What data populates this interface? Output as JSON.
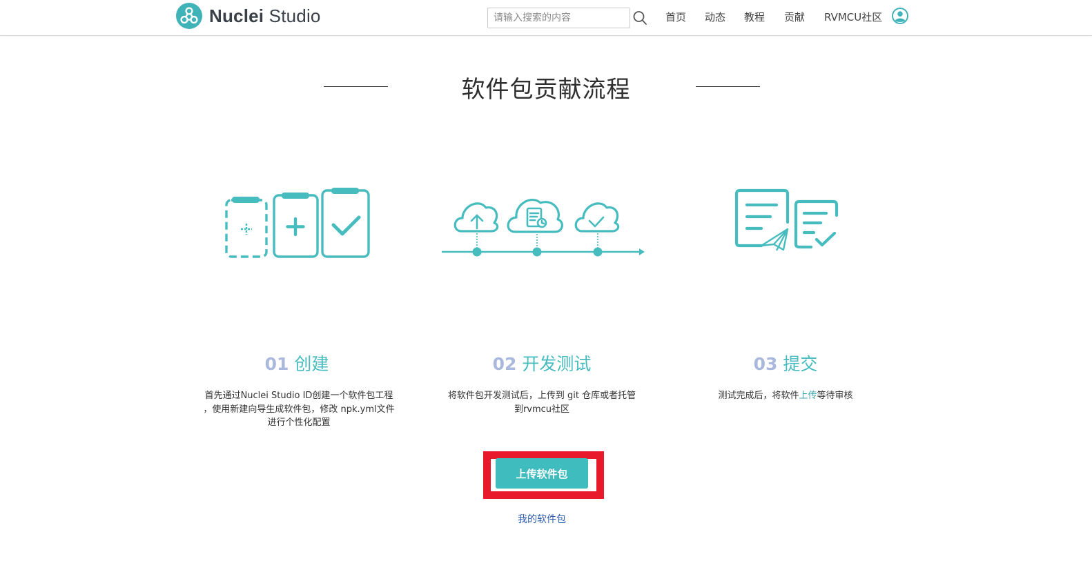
{
  "header": {
    "brand_bold": "Nuclei",
    "brand_rest": " Studio",
    "search_placeholder": "请输入搜索的内容",
    "nav": [
      "首页",
      "动态",
      "教程",
      "贡献",
      "RVMCU社区"
    ]
  },
  "page_title": "软件包贡献流程",
  "steps": [
    {
      "num": "01",
      "title": "创建",
      "desc_lines": [
        "首先通过Nuclei Studio ID创建一个软件包工程",
        "，使用新建向导生成软件包，修改 npk.yml文件",
        "进行个性化配置"
      ]
    },
    {
      "num": "02",
      "title": "开发测试",
      "desc_lines": [
        "将软件包开发测试后，上传到 git 仓库或者托管",
        "到rvmcu社区"
      ]
    },
    {
      "num": "03",
      "title": "提交",
      "desc_pre": "测试完成后，将软件",
      "desc_hl": "上传",
      "desc_post": "等待审核"
    }
  ],
  "upload_button": "上传软件包",
  "my_packages_link": "我的软件包",
  "colors": {
    "teal": "#46bcbf",
    "num": "#a9b8dc",
    "highlight": "#e8192b",
    "link": "#2a5db0"
  }
}
